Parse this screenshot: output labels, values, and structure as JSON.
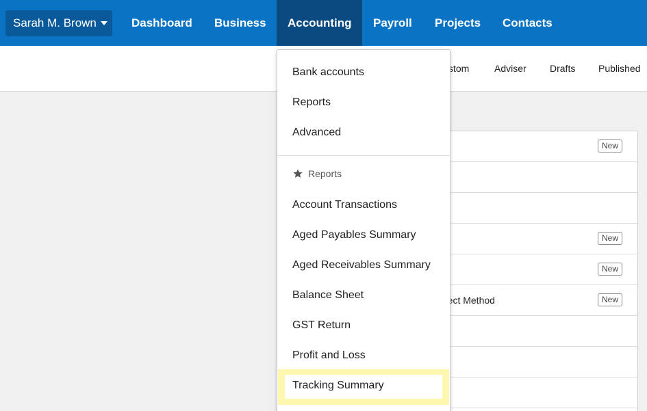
{
  "topnav": {
    "org": "Sarah M. Brown",
    "items": [
      "Dashboard",
      "Business",
      "Accounting",
      "Payroll",
      "Projects",
      "Contacts"
    ],
    "active": "Accounting"
  },
  "subnav": {
    "tabs": [
      "stom",
      "Adviser",
      "Drafts",
      "Published"
    ]
  },
  "dropdown": {
    "items": [
      "Bank accounts",
      "Reports",
      "Advanced"
    ],
    "section_header": "Reports",
    "reports": [
      "Account Transactions",
      "Aged Payables Summary",
      "Aged Receivables Summary",
      "Balance Sheet",
      "GST Return",
      "Profit and Loss",
      "Tracking Summary"
    ],
    "highlighted": "Tracking Summary"
  },
  "report_list": {
    "rows": [
      {
        "text": "",
        "badge": "New"
      },
      {
        "text": "",
        "badge": ""
      },
      {
        "text": "",
        "badge": ""
      },
      {
        "text": "",
        "badge": "New"
      },
      {
        "text": "",
        "badge": "New"
      },
      {
        "text": "rect Method",
        "badge": "New"
      },
      {
        "text": "",
        "badge": ""
      },
      {
        "text": "",
        "badge": ""
      },
      {
        "text": "",
        "badge": ""
      }
    ]
  },
  "colors": {
    "nav_bg": "#0a73c4",
    "nav_active": "#0a4a80",
    "org_btn": "#0a5a9b",
    "highlight": "#fdf7b0"
  },
  "icons": {
    "section_header": "star-icon",
    "org_caret": "caret-down-icon"
  }
}
